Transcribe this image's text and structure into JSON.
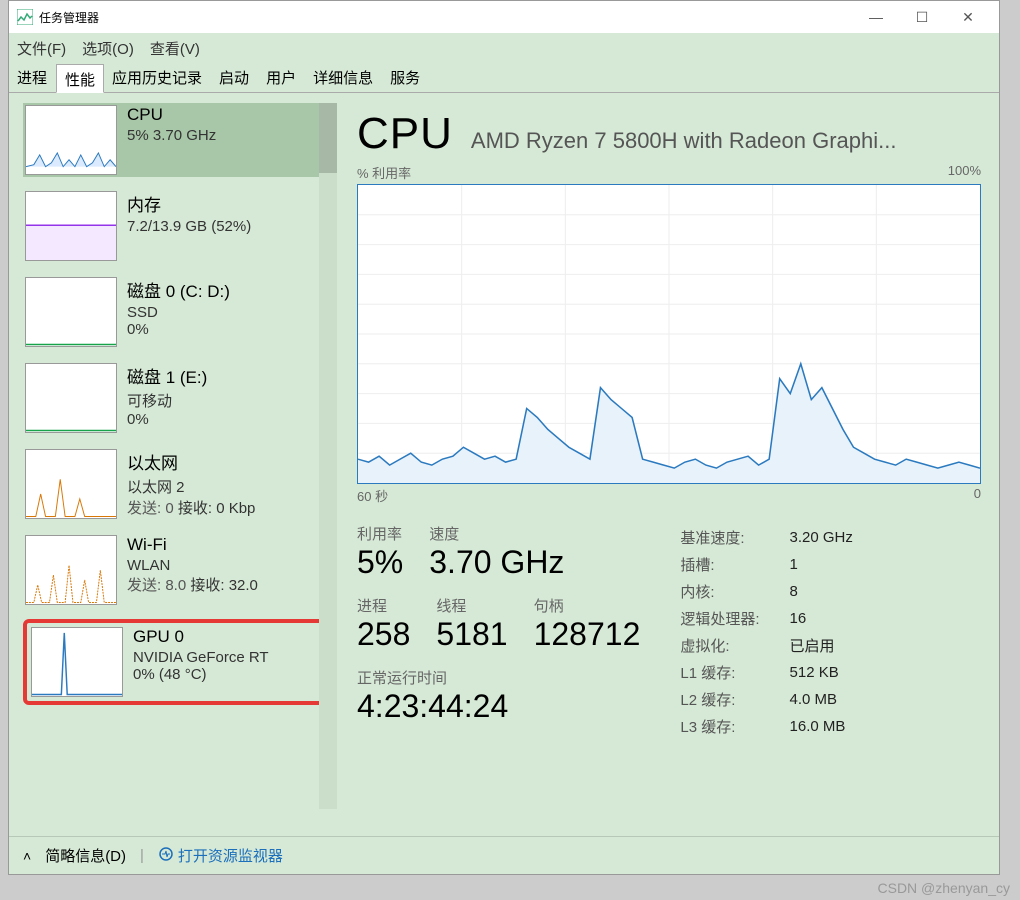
{
  "window": {
    "title": "任务管理器"
  },
  "menu": {
    "file": "文件(F)",
    "options": "选项(O)",
    "view": "查看(V)"
  },
  "tabs": [
    "进程",
    "性能",
    "应用历史记录",
    "启动",
    "用户",
    "详细信息",
    "服务"
  ],
  "activeTab": 1,
  "sidebar": [
    {
      "title": "CPU",
      "line1": "5%  3.70 GHz",
      "line2": "",
      "selected": true,
      "style": "cpu"
    },
    {
      "title": "内存",
      "line1": "7.2/13.9 GB (52%)",
      "line2": "",
      "style": "mem"
    },
    {
      "title": "磁盘 0 (C: D:)",
      "line1": "SSD",
      "line2": "0%",
      "style": "disk"
    },
    {
      "title": "磁盘 1 (E:)",
      "line1": "可移动",
      "line2": "0%",
      "style": "disk"
    },
    {
      "title": "以太网",
      "line1": "以太网 2",
      "net_send": "发送: 0",
      "net_recv": "接收: 0 Kbp",
      "style": "net"
    },
    {
      "title": "Wi-Fi",
      "line1": "WLAN",
      "net_send": "发送: 8.0",
      "net_recv": "接收: 32.0",
      "style": "net"
    },
    {
      "title": "GPU 0",
      "line1": "NVIDIA GeForce RT",
      "line2": "0%  (48 °C)",
      "highlighted": true,
      "style": "gpu"
    }
  ],
  "main": {
    "title": "CPU",
    "subtitle": "AMD Ryzen 7 5800H with Radeon Graphi...",
    "chart_top_left": "% 利用率",
    "chart_top_right": "100%",
    "chart_bottom_left": "60 秒",
    "chart_bottom_right": "0",
    "stats_row1_labels": [
      "利用率",
      "速度"
    ],
    "stats_row1_vals": [
      "5%",
      "3.70 GHz"
    ],
    "stats_row2_labels": [
      "进程",
      "线程",
      "句柄"
    ],
    "stats_row2_vals": [
      "258",
      "5181",
      "128712"
    ],
    "uptime_label": "正常运行时间",
    "uptime": "4:23:44:24",
    "info": [
      [
        "基准速度:",
        "3.20 GHz"
      ],
      [
        "插槽:",
        "1"
      ],
      [
        "内核:",
        "8"
      ],
      [
        "逻辑处理器:",
        "16"
      ],
      [
        "虚拟化:",
        "已启用"
      ],
      [
        "L1 缓存:",
        "512 KB"
      ],
      [
        "L2 缓存:",
        "4.0 MB"
      ],
      [
        "L3 缓存:",
        "16.0 MB"
      ]
    ]
  },
  "footer": {
    "brief": "简略信息(D)",
    "monitor": "打开资源监视器"
  },
  "watermark": "CSDN @zhenyan_cy",
  "chart_data": {
    "type": "line",
    "title": "% 利用率",
    "ylim": [
      0,
      100
    ],
    "xlim_label": "60 秒 → 0",
    "values": [
      8,
      7,
      9,
      6,
      8,
      10,
      7,
      6,
      8,
      9,
      12,
      10,
      8,
      9,
      7,
      8,
      25,
      22,
      18,
      15,
      12,
      10,
      8,
      32,
      28,
      25,
      22,
      8,
      7,
      6,
      5,
      7,
      8,
      6,
      5,
      7,
      8,
      9,
      6,
      8,
      35,
      30,
      40,
      28,
      32,
      25,
      18,
      12,
      10,
      8,
      7,
      6,
      8,
      7,
      6,
      5,
      6,
      7,
      6,
      5
    ]
  }
}
